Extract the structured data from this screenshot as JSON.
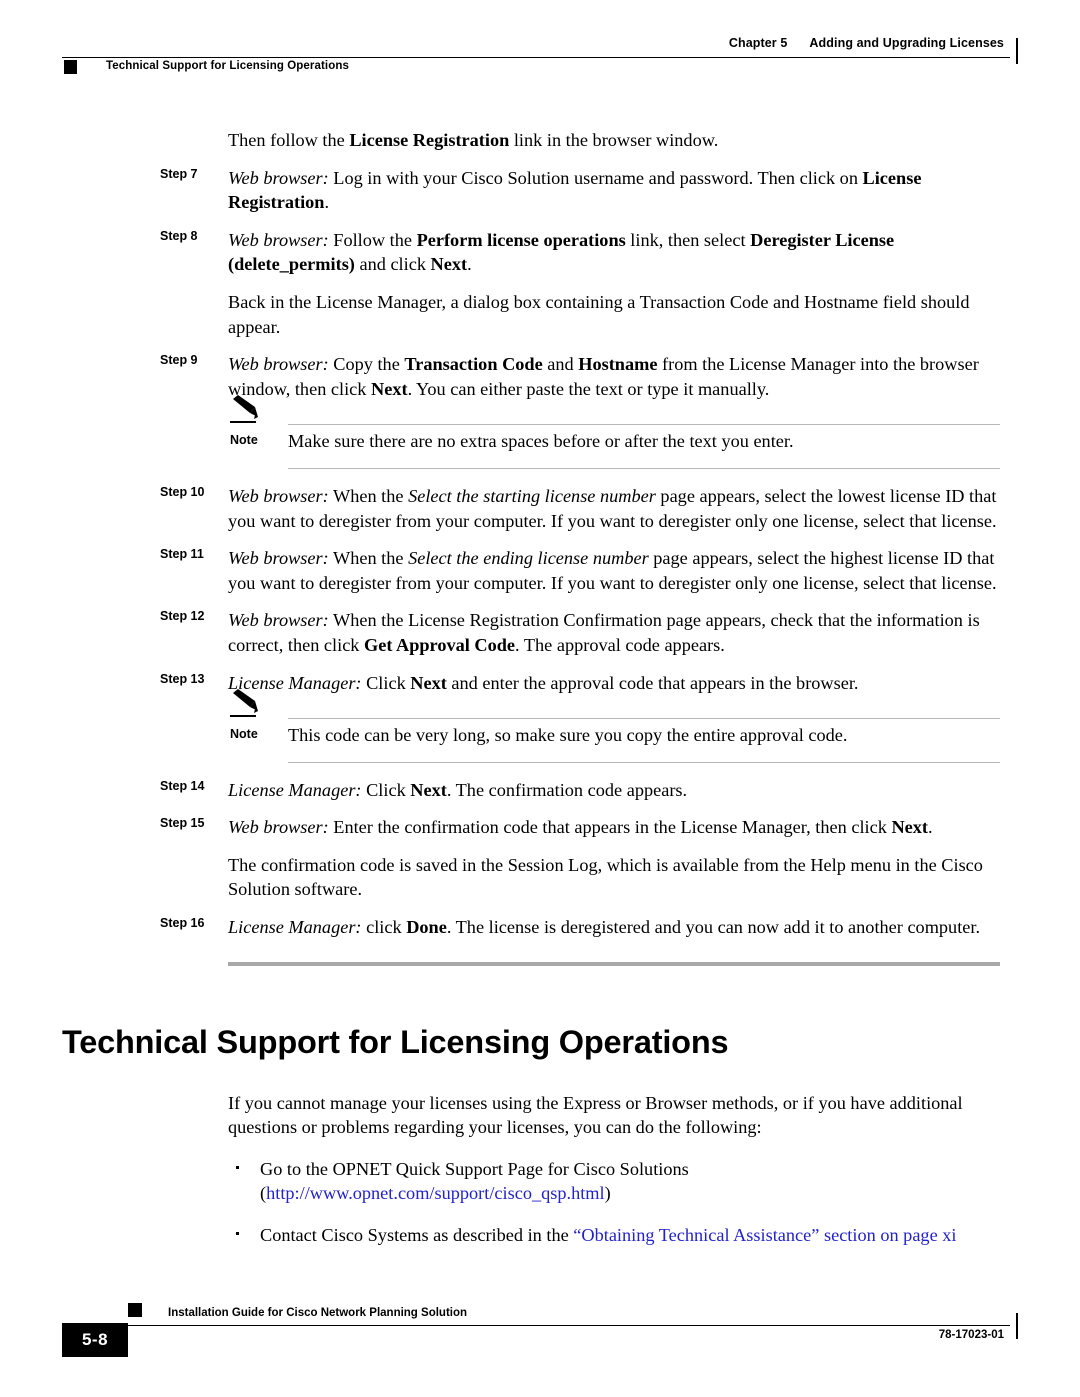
{
  "header": {
    "chapter": "Chapter 5",
    "chapter_title": "Adding and Upgrading Licenses",
    "section": "Technical Support for Licensing Operations"
  },
  "intro": {
    "text_before": "Then follow the ",
    "bold": "License Registration",
    "text_after": " link in the browser window."
  },
  "steps": [
    {
      "label": "Step 7",
      "role": "Web browser:",
      "t1": " Log in with your Cisco Solution username and password. Then click on ",
      "b1": "License Registration",
      "t2": "."
    },
    {
      "label": "Step 8",
      "role": "Web browser:",
      "t1": " Follow the ",
      "b1": "Perform license operations",
      "t2": " link, then select ",
      "b2": "Deregister License (delete_permits)",
      "t3": " and click ",
      "b3": "Next",
      "t4": "."
    },
    {
      "label": "Step 9",
      "role": "Web browser:",
      "t1": " Copy the ",
      "b1": "Transaction Code",
      "t2": " and ",
      "b2": "Hostname",
      "t3": " from the License Manager into the browser window, then click ",
      "b3": "Next",
      "t4": ". You can either paste the text or type it manually."
    },
    {
      "label": "Step 10",
      "role": "Web browser:",
      "t1": " When the ",
      "i1": "Select the starting license number",
      "t2": " page appears, select the lowest license ID that you want to deregister from your computer. If you want to deregister only one license, select that license."
    },
    {
      "label": "Step 11",
      "role": "Web browser:",
      "t1": " When the ",
      "i1": "Select the ending license number",
      "t2": " page appears, select the highest license ID that you want to deregister from your computer. If you want to deregister only one license, select that license."
    },
    {
      "label": "Step 12",
      "role": "Web browser:",
      "t1": " When the License Registration Confirmation page appears, check that the information is correct, then click ",
      "b1": "Get Approval Code",
      "t2": ". The approval code appears."
    },
    {
      "label": "Step 13",
      "role": "License Manager:",
      "t1": " Click ",
      "b1": "Next",
      "t2": " and enter the approval code that appears in the browser."
    },
    {
      "label": "Step 14",
      "role": "License Manager:",
      "t1": " Click ",
      "b1": "Next",
      "t2": ". The confirmation code appears."
    },
    {
      "label": "Step 15",
      "role": "Web browser:",
      "t1": " Enter the confirmation code that appears in the License Manager, then click ",
      "b1": "Next",
      "t2": "."
    },
    {
      "label": "Step 16",
      "role": "License Manager:",
      "t1": " click ",
      "b1": "Done",
      "t2": ". The license is deregistered and you can now add it to another computer."
    }
  ],
  "paragraphs": {
    "after_step8": "Back in the License Manager, a dialog box containing a Transaction Code and Hostname field should appear.",
    "after_step15": "The confirmation code is saved in the Session Log, which is available from the Help menu in the Cisco Solution software."
  },
  "notes": [
    {
      "label": "Note",
      "icon": "pencil-icon",
      "text": "Make sure there are no extra spaces before or after the text you enter."
    },
    {
      "label": "Note",
      "icon": "pencil-icon",
      "text": "This code can be very long, so make sure you copy the entire approval code."
    }
  ],
  "section": {
    "heading": "Technical Support for Licensing Operations",
    "intro": "If you cannot manage your licenses using the Express or Browser methods, or if you have additional questions or problems regarding your licenses, you can do the following:",
    "bullets": [
      {
        "text": "Go to the OPNET Quick Support Page for Cisco Solutions",
        "paren_open": "(",
        "link": "http://www.opnet.com/support/cisco_qsp.html",
        "paren_close": ")"
      },
      {
        "text_before": "Contact Cisco Systems as described in the ",
        "link": "“Obtaining Technical Assistance” section on page xi",
        "text_after": ""
      }
    ]
  },
  "footer": {
    "page_number": "5-8",
    "title": "Installation Guide for Cisco Network Planning Solution",
    "doc_number": "78-17023-01"
  },
  "colors": {
    "link": "#2222cc",
    "rule_gray": "#b6b6b6",
    "divider_gray": "#a8a8a8"
  }
}
